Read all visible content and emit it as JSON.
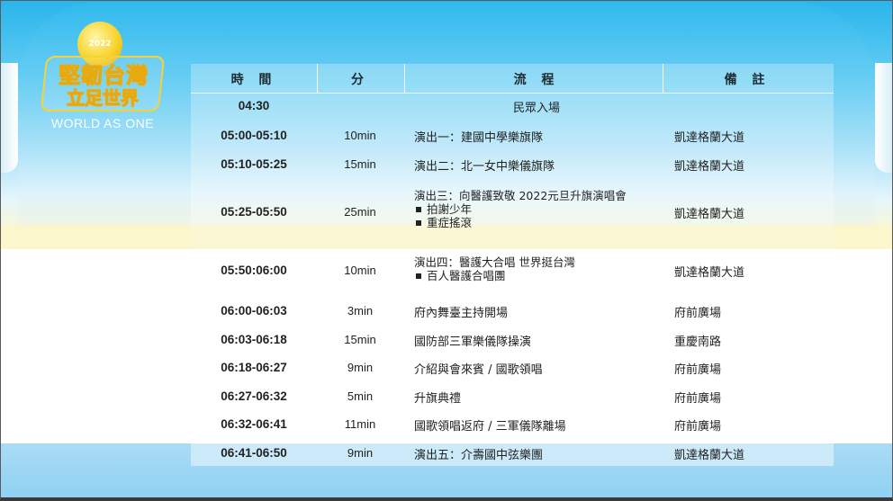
{
  "logo": {
    "year": "2022",
    "line1": "堅韌台灣",
    "line2": "立足世界",
    "line3": "WORLD AS ONE"
  },
  "headers": {
    "time": "時 間",
    "minutes": "分",
    "program": "流 程",
    "notes": "備 註"
  },
  "opening": {
    "time": "04:30",
    "event": "民眾入場"
  },
  "rows": [
    {
      "time": "05:00-05:10",
      "minutes": "10min",
      "program": "演出一：建國中學樂旗隊",
      "subs": [],
      "note": "凱達格蘭大道"
    },
    {
      "time": "05:10-05:25",
      "minutes": "15min",
      "program": "演出二：北一女中樂儀旗隊",
      "subs": [],
      "note": "凱達格蘭大道"
    },
    {
      "time": "05:25-05:50",
      "minutes": "25min",
      "program": "演出三：向醫護致敬  2022元旦升旗演唱會",
      "subs": [
        "拍謝少年",
        "重症搖滾"
      ],
      "note": "凱達格蘭大道"
    },
    {
      "time": "05:50:06:00",
      "minutes": "10min",
      "program": "演出四：醫護大合唱 世界挺台灣",
      "subs": [
        "百人醫護合唱團"
      ],
      "note": "凱達格蘭大道"
    },
    {
      "time": "06:00-06:03",
      "minutes": "3min",
      "program": "府內舞臺主持開場",
      "subs": [],
      "note": "府前廣場"
    },
    {
      "time": "06:03-06:18",
      "minutes": "15min",
      "program": "國防部三軍樂儀隊操演",
      "subs": [],
      "note": "重慶南路"
    },
    {
      "time": "06:18-06:27",
      "minutes": "9min",
      "program": "介紹與會來賓 / 國歌領唱",
      "subs": [],
      "note": "府前廣場"
    },
    {
      "time": "06:27-06:32",
      "minutes": "5min",
      "program": "升旗典禮",
      "subs": [],
      "note": "府前廣場"
    },
    {
      "time": "06:32-06:41",
      "minutes": "11min",
      "program": "國歌領唱返府 / 三軍儀隊離場",
      "subs": [],
      "note": "府前廣場"
    },
    {
      "time": "06:41-06:50",
      "minutes": "9min",
      "program": "演出五：介壽國中弦樂團",
      "subs": [],
      "note": "凱達格蘭大道"
    }
  ]
}
